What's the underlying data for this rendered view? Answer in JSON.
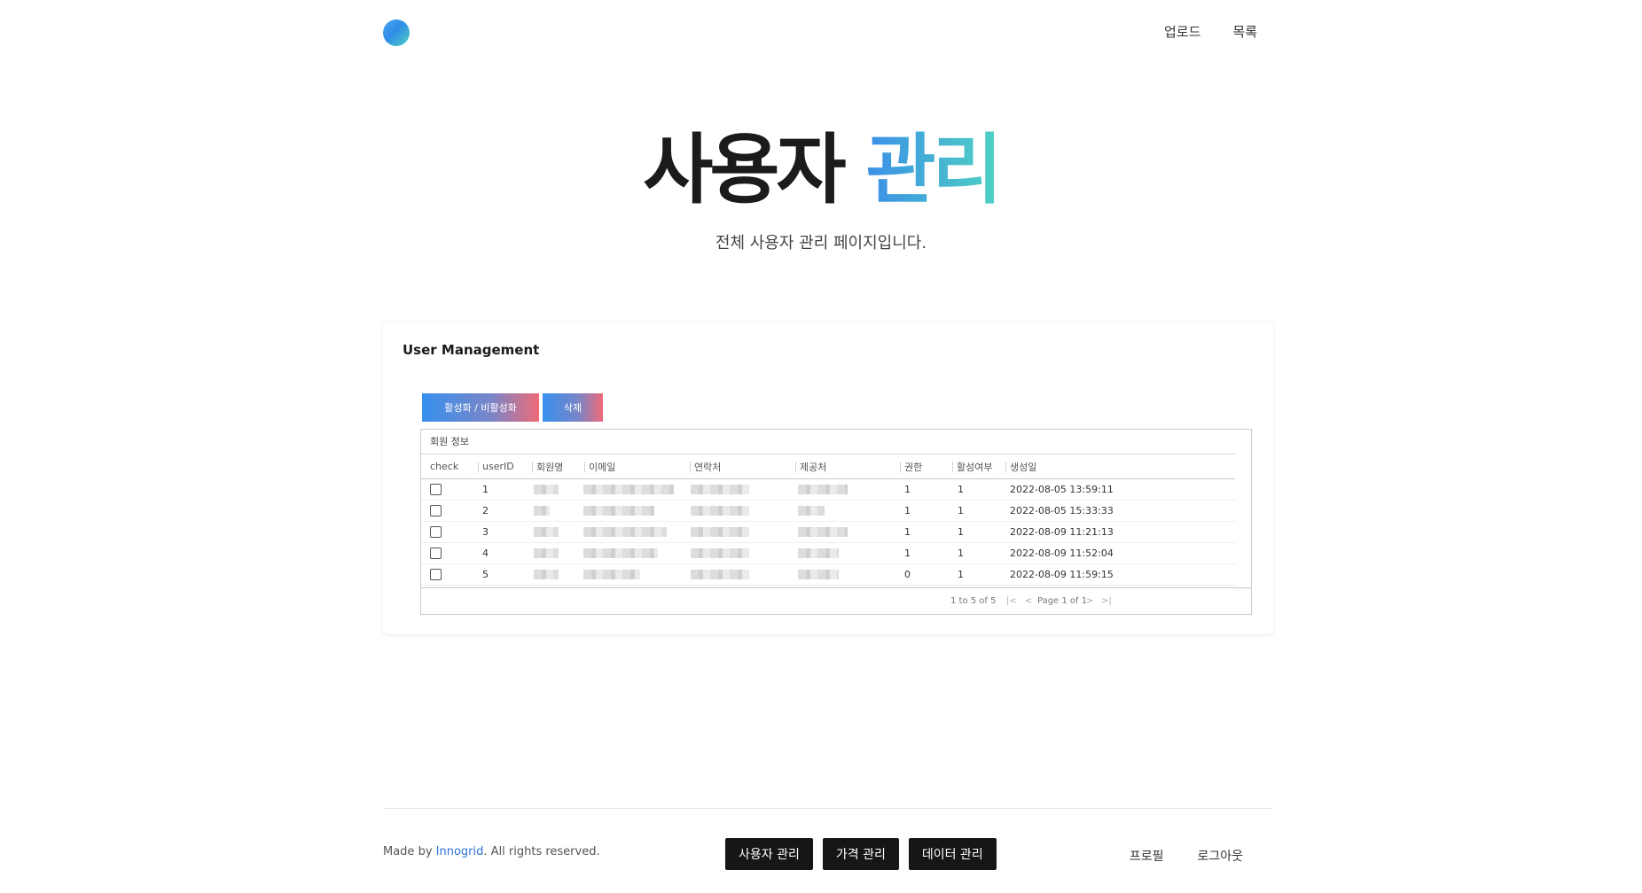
{
  "nav": {
    "upload": "업로드",
    "list": "목록"
  },
  "hero": {
    "title_main": "사용자",
    "title_accent": "관리",
    "subtitle": "전체 사용자 관리 페이지입니다."
  },
  "card": {
    "title": "User Management",
    "buttons": {
      "toggle_active": "활성화 / 비활성화",
      "delete": "삭제"
    },
    "grid": {
      "group_header": "회원 정보",
      "columns": [
        "check",
        "userID",
        "회원명",
        "이메일",
        "연락처",
        "제공처",
        "권한",
        "활성여부",
        "생성일"
      ],
      "rows": [
        {
          "userID": "1",
          "role": "1",
          "active": "1",
          "created": "2022-08-05 13:59:11"
        },
        {
          "userID": "2",
          "role": "1",
          "active": "1",
          "created": "2022-08-05 15:33:33"
        },
        {
          "userID": "3",
          "role": "1",
          "active": "1",
          "created": "2022-08-09 11:21:13"
        },
        {
          "userID": "4",
          "role": "1",
          "active": "1",
          "created": "2022-08-09 11:52:04"
        },
        {
          "userID": "5",
          "role": "0",
          "active": "1",
          "created": "2022-08-09 11:59:15"
        }
      ],
      "footer": {
        "row_summary": "1 to 5 of 5",
        "page_label": "Page 1 of 1"
      }
    }
  },
  "footer": {
    "made_by_prefix": "Made by ",
    "brand": "Innogrid",
    "made_by_suffix": ". All rights reserved.",
    "buttons": [
      "사용자 관리",
      "가격 관리",
      "데이터 관리"
    ],
    "links": {
      "profile": "프로필",
      "logout": "로그아웃"
    }
  },
  "colors": {
    "accent_start": "#3b8fe8",
    "accent_end": "#4fd2c2",
    "button_dark": "#161616",
    "brand_link": "#2f72d6"
  }
}
